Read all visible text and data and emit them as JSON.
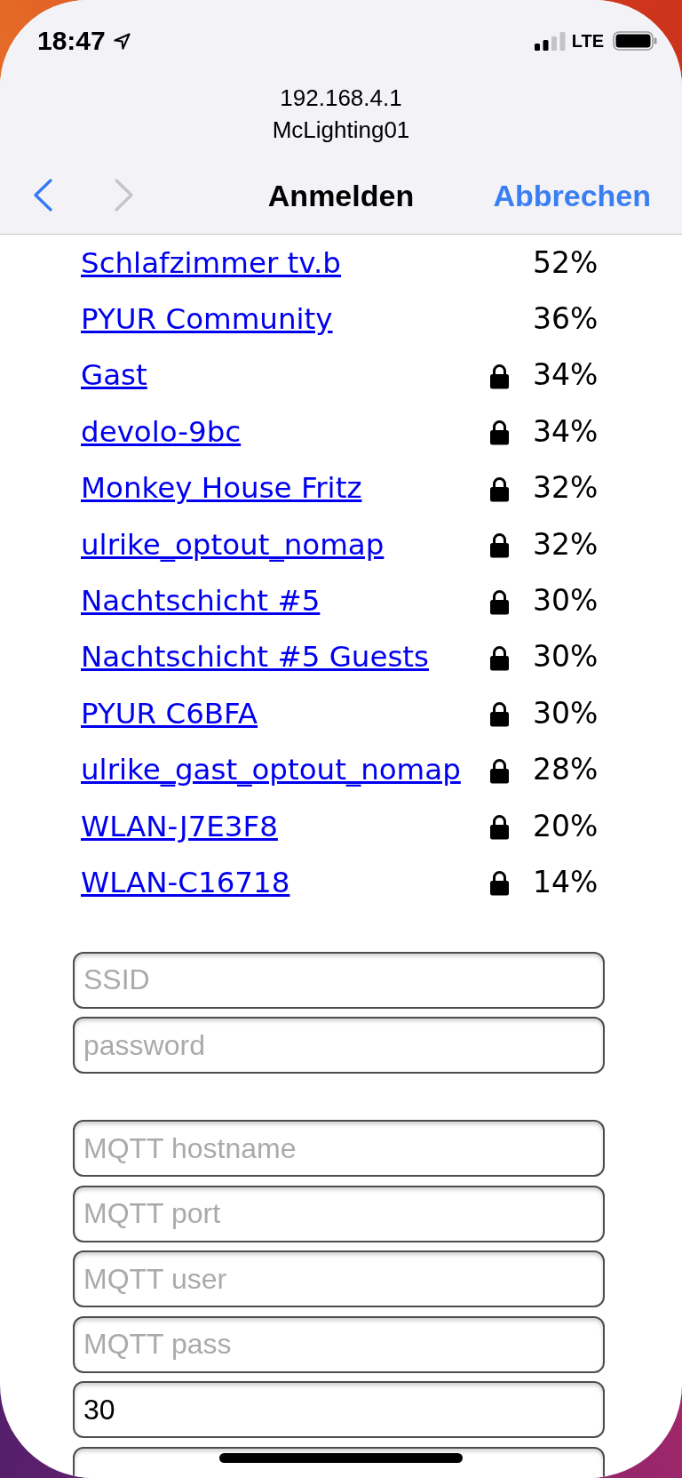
{
  "status_bar": {
    "time": "18:47",
    "network": "LTE"
  },
  "address": {
    "host": "192.168.4.1",
    "page_name": "McLighting01"
  },
  "nav": {
    "back": {
      "disabled": false
    },
    "forward": {
      "disabled": true
    },
    "title": "Anmelden",
    "action": "Abbrechen"
  },
  "networks": [
    {
      "name": "Schlafzimmer tv.b",
      "locked": false,
      "signal": "52%"
    },
    {
      "name": "PYUR Community",
      "locked": false,
      "signal": "36%"
    },
    {
      "name": "Gast",
      "locked": true,
      "signal": "34%"
    },
    {
      "name": "devolo-9bc",
      "locked": true,
      "signal": "34%"
    },
    {
      "name": "Monkey House Fritz",
      "locked": true,
      "signal": "32%"
    },
    {
      "name": "ulrike_optout_nomap",
      "locked": true,
      "signal": "32%"
    },
    {
      "name": "Nachtschicht #5",
      "locked": true,
      "signal": "30%"
    },
    {
      "name": "Nachtschicht #5 Guests",
      "locked": true,
      "signal": "30%"
    },
    {
      "name": "PYUR C6BFA",
      "locked": true,
      "signal": "30%"
    },
    {
      "name": "ulrike_gast_optout_nomap",
      "locked": true,
      "signal": "28%"
    },
    {
      "name": "WLAN-J7E3F8",
      "locked": true,
      "signal": "20%"
    },
    {
      "name": "WLAN-C16718",
      "locked": true,
      "signal": "14%"
    }
  ],
  "form": {
    "sections": [
      {
        "fields": [
          {
            "kind": "text",
            "placeholder": "SSID"
          },
          {
            "kind": "text",
            "placeholder": "password"
          }
        ]
      },
      {
        "fields": [
          {
            "kind": "text",
            "placeholder": "MQTT hostname"
          },
          {
            "kind": "text",
            "placeholder": "MQTT port"
          },
          {
            "kind": "text",
            "placeholder": "MQTT user"
          },
          {
            "kind": "text",
            "placeholder": "MQTT pass"
          },
          {
            "kind": "text",
            "value": "30"
          },
          {
            "kind": "text"
          }
        ]
      }
    ]
  }
}
